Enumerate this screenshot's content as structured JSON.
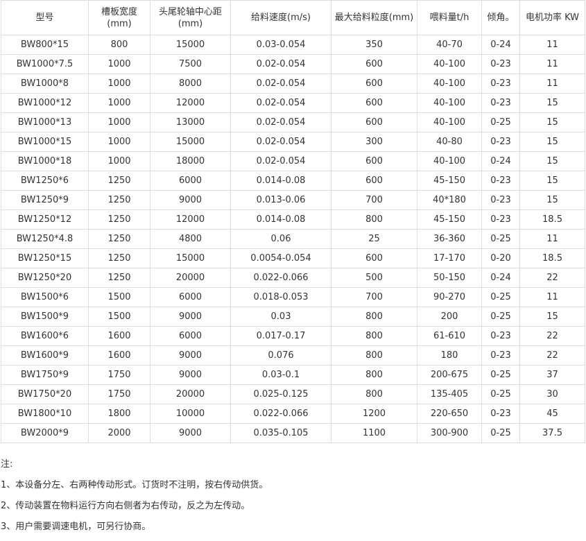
{
  "table": {
    "headers": [
      "型号",
      "槽板宽度(mm)",
      "头尾轮轴中心距(mm)",
      "给料速度(m/s)",
      "最大给料粒度(mm)",
      "喂料量t/h",
      "倾角。",
      "电机功率 KW"
    ],
    "rows": [
      [
        "BW800*15",
        "800",
        "15000",
        "0.03-0.054",
        "350",
        "40-70",
        "0-24",
        "11"
      ],
      [
        "BW1000*7.5",
        "1000",
        "7500",
        "0.02-0.054",
        "600",
        "40-100",
        "0-23",
        "11"
      ],
      [
        "BW1000*8",
        "1000",
        "8000",
        "0.02-0.054",
        "600",
        "40-100",
        "0-23",
        "11"
      ],
      [
        "BW1000*12",
        "1000",
        "12000",
        "0.02-0.054",
        "600",
        "40-100",
        "0-23",
        "15"
      ],
      [
        "BW1000*13",
        "1000",
        "13000",
        "0.02-0.054",
        "600",
        "40-100",
        "0-25",
        "15"
      ],
      [
        "BW1000*15",
        "1000",
        "15000",
        "0.02-0.054",
        "300",
        "40-80",
        "0-23",
        "15"
      ],
      [
        "BW1000*18",
        "1000",
        "18000",
        "0.02-0.054",
        "600",
        "40-100",
        "0-24",
        "15"
      ],
      [
        "BW1250*6",
        "1250",
        "6000",
        "0.014-0.08",
        "600",
        "45-150",
        "0-23",
        "15"
      ],
      [
        "BW1250*9",
        "1250",
        "9000",
        "0.013-0.06",
        "700",
        "40*180",
        "0-23",
        "15"
      ],
      [
        "BW1250*12",
        "1250",
        "12000",
        "0.014-0.08",
        "800",
        "45-150",
        "0-23",
        "18.5"
      ],
      [
        "BW1250*4.8",
        "1250",
        "4800",
        "0.06",
        "25",
        "36-360",
        "0-25",
        "11"
      ],
      [
        "BW1250*15",
        "1250",
        "15000",
        "0.0054-0.054",
        "600",
        "17-170",
        "0-20",
        "18.5"
      ],
      [
        "BW1250*20",
        "1250",
        "20000",
        "0.022-0.066",
        "500",
        "50-150",
        "0-24",
        "22"
      ],
      [
        "BW1500*6",
        "1500",
        "6000",
        "0.018-0.053",
        "700",
        "90-270",
        "0-25",
        "11"
      ],
      [
        "BW1500*9",
        "1500",
        "9000",
        "0.03",
        "800",
        "200",
        "0-25",
        "15"
      ],
      [
        "BW1600*6",
        "1600",
        "6000",
        "0.017-0.17",
        "800",
        "61-610",
        "0-23",
        "22"
      ],
      [
        "BW1600*9",
        "1600",
        "9000",
        "0.076",
        "800",
        "180",
        "0-23",
        "22"
      ],
      [
        "BW1750*9",
        "1750",
        "9000",
        "0.03-0.1",
        "800",
        "200-675",
        "0-25",
        "37"
      ],
      [
        "BW1750*20",
        "1750",
        "20000",
        "0.025-0.125",
        "800",
        "135-405",
        "0-25",
        "30"
      ],
      [
        "BW1800*10",
        "1800",
        "10000",
        "0.022-0.066",
        "1200",
        "220-650",
        "0-23",
        "45"
      ],
      [
        "BW2000*9",
        "2000",
        "9000",
        "0.035-0.105",
        "1100",
        "300-900",
        "0-25",
        "37.5"
      ]
    ]
  },
  "notes": {
    "title": "注:",
    "items": [
      "1、本设备分左、右两种传动形式。订货时不注明，按右传动供货。",
      "2、传动装置在物料运行方向右侧者为右传动，反之为左传动。",
      "3、用户需要调速电机，可另行协商。"
    ]
  }
}
